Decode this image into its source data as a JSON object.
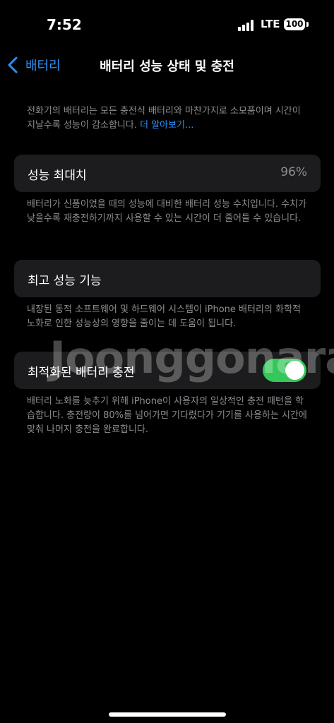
{
  "status_bar": {
    "time": "7:52",
    "network": "LTE",
    "battery": "100"
  },
  "nav": {
    "back_label": "배터리",
    "title": "배터리 성능 상태 및 충전"
  },
  "intro": {
    "text": "전화기의 배터리는 모든 충전식 배터리와 마찬가지로 소모품이며 시간이 지날수록 성능이 감소합니다. ",
    "link": "더 알아보기..."
  },
  "max_capacity": {
    "label": "성능 최대치",
    "value": "96%",
    "description": "배터리가 신품이었을 때의 성능에 대비한 배터리 성능 수치입니다. 수치가 낮을수록 재충전하기까지 사용할 수 있는 시간이 더 줄어들 수 있습니다."
  },
  "peak_performance": {
    "label": "최고 성능 기능",
    "description": "내장된 동적 소프트웨어 및 하드웨어 시스템이 iPhone 배터리의 화학적 노화로 인한 성능상의 영향을 줄이는 데 도움이 됩니다."
  },
  "optimized_charging": {
    "label": "최적화된 배터리 충전",
    "enabled": true,
    "description": "배터리 노화를 늦추기 위해 iPhone이 사용자의 일상적인 충전 패턴을 학습합니다. 충전량이 80%를 넘어가면 기다렸다가 기기를 사용하는 시간에 맞춰 나머지 충전을 완료합니다."
  },
  "watermark": "Joonggonara",
  "colors": {
    "accent": "#2f8ff5",
    "toggle_on": "#34c759",
    "row_bg": "#1c1c1e",
    "secondary_text": "#8e8e93"
  }
}
